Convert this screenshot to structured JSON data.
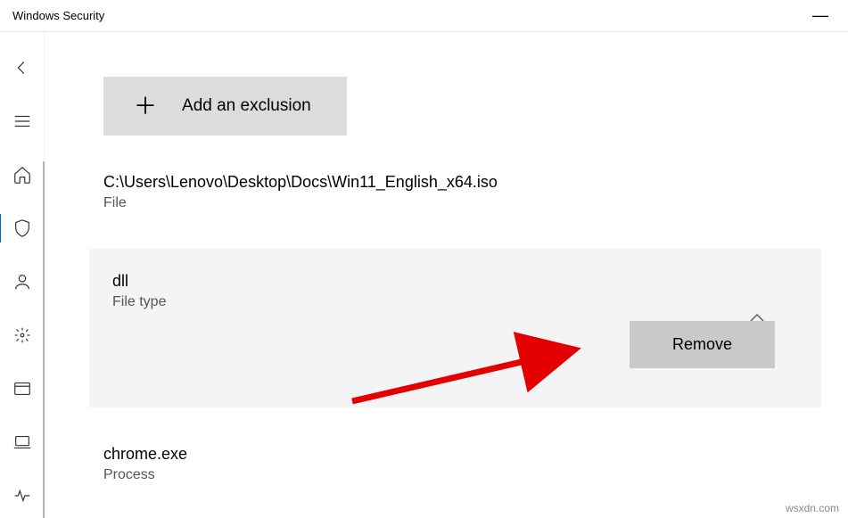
{
  "window": {
    "title": "Windows Security",
    "minimize_glyph": "—"
  },
  "nav": {
    "back": "back",
    "menu": "menu",
    "home": "home",
    "shield": "virus-protection",
    "account": "account-protection",
    "firewall": "firewall-network",
    "app_browser": "app-browser-control",
    "device": "device-security",
    "health": "device-performance"
  },
  "actions": {
    "add_label": "Add an exclusion",
    "remove_label": "Remove"
  },
  "exclusions": [
    {
      "title": "C:\\Users\\Lenovo\\Desktop\\Docs\\Win11_English_x64.iso",
      "type": "File"
    },
    {
      "title": "dll",
      "type": "File type"
    },
    {
      "title": "chrome.exe",
      "type": "Process"
    }
  ],
  "watermark": "wsxdn.com"
}
